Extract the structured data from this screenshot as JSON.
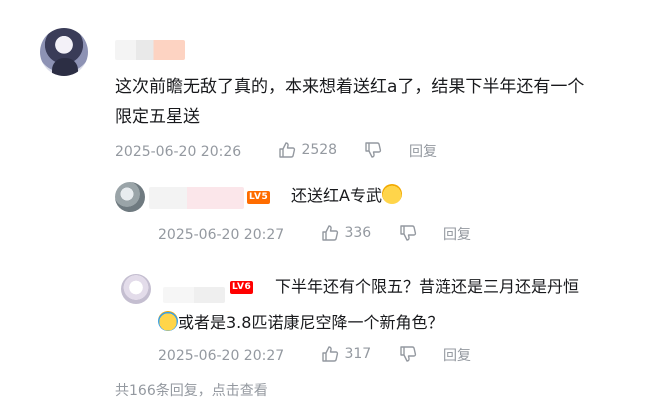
{
  "comment": {
    "text_line1": "这次前瞻无敌了真的，本来想着送红a了，结果下半年还有一个",
    "text_line2": "限定五星送",
    "time": "2025-06-20 20:26",
    "likes": "2528",
    "reply_label": "回复"
  },
  "replies": [
    {
      "level": "LV5",
      "text": "还送红A专武",
      "emoji": "cat-emoji",
      "time": "2025-06-20 20:27",
      "likes": "336",
      "reply_label": "回复"
    },
    {
      "level": "LV6",
      "text_line1": "下半年还有个限五？昔涟还是三月还是丹恒",
      "text_line2": "或者是3.8匹诺康尼空降一个新角色？",
      "emoji": "crying-emoji",
      "time": "2025-06-20 20:27",
      "likes": "317",
      "reply_label": "回复"
    }
  ],
  "footer": {
    "text": "共166条回复，点击查看"
  },
  "colors": {
    "text": "#18191c",
    "meta": "#9499a0",
    "lv5": "#ff6c00",
    "lv6": "#ff0000"
  }
}
